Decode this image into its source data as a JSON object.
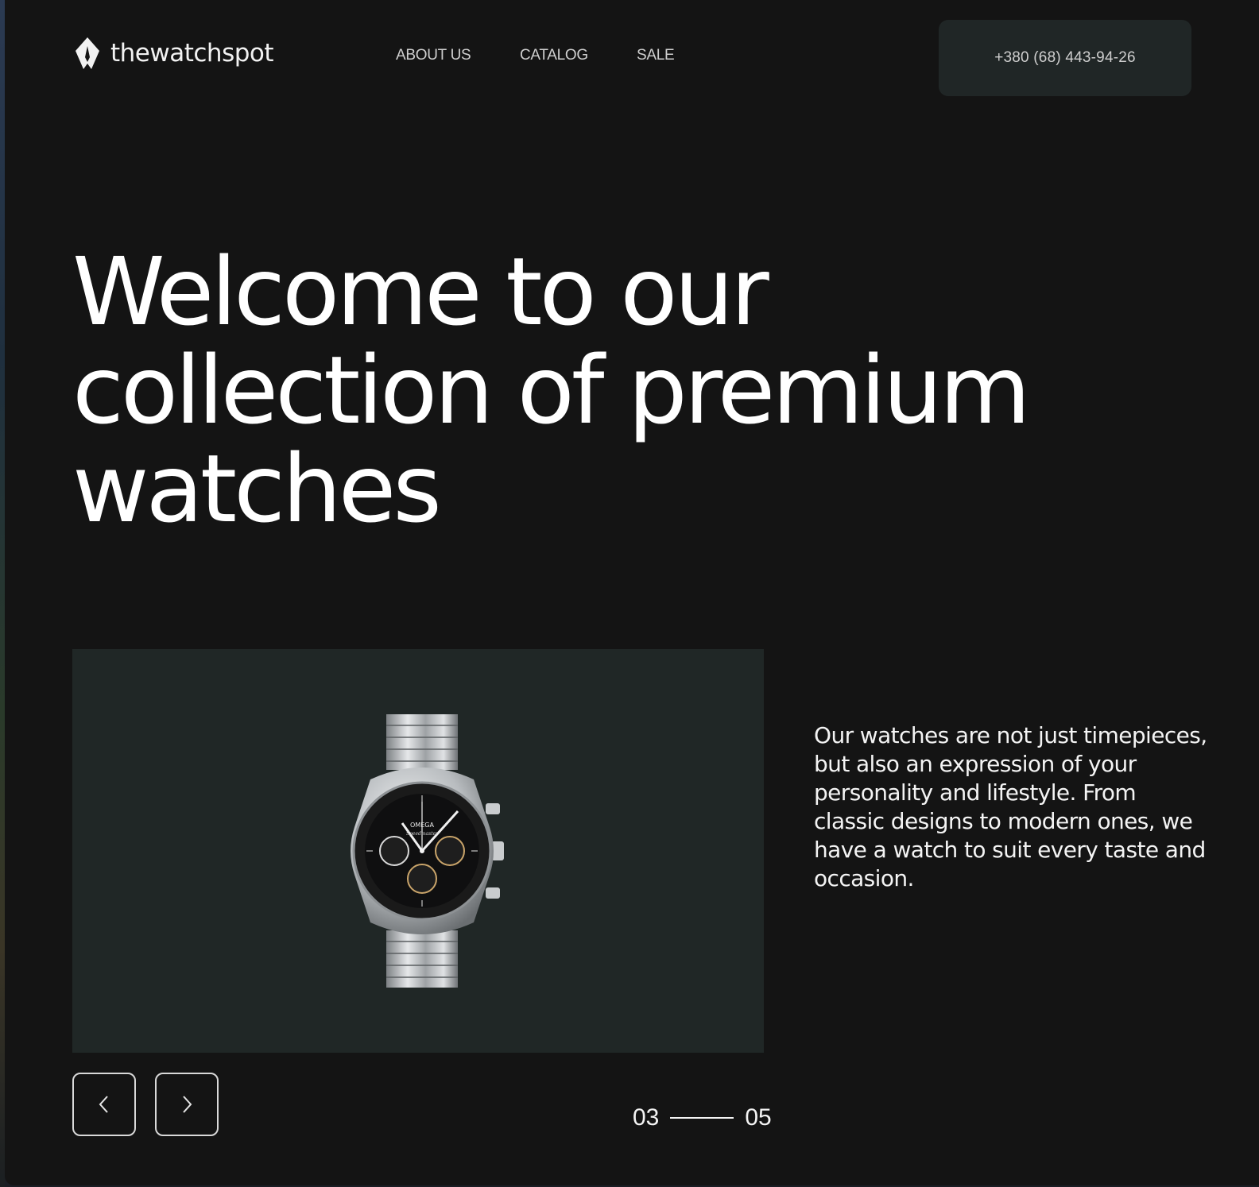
{
  "header": {
    "logo_text": "thewatchspot",
    "nav": [
      "ABOUT US",
      "CATALOG",
      "SALE"
    ],
    "phone": "+380 (68) 443-94-26"
  },
  "hero": {
    "title": "Welcome to our collection of premium watches",
    "image_alt": "OMEGA Speedmaster chronograph wristwatch",
    "watch_brand": "OMEGA",
    "watch_model": "Speedmaster"
  },
  "description": "Our watches are not just timepieces, but also an expression of your personality and lifestyle. From classic designs to modern ones, we have a watch to suit every taste and occasion.",
  "slider": {
    "current": "03",
    "total": "05",
    "prev_icon": "chevron-left-icon",
    "next_icon": "chevron-right-icon"
  },
  "colors": {
    "background": "#141414",
    "panel": "#202726",
    "phone_button": "#202626",
    "text": "#ffffff"
  }
}
